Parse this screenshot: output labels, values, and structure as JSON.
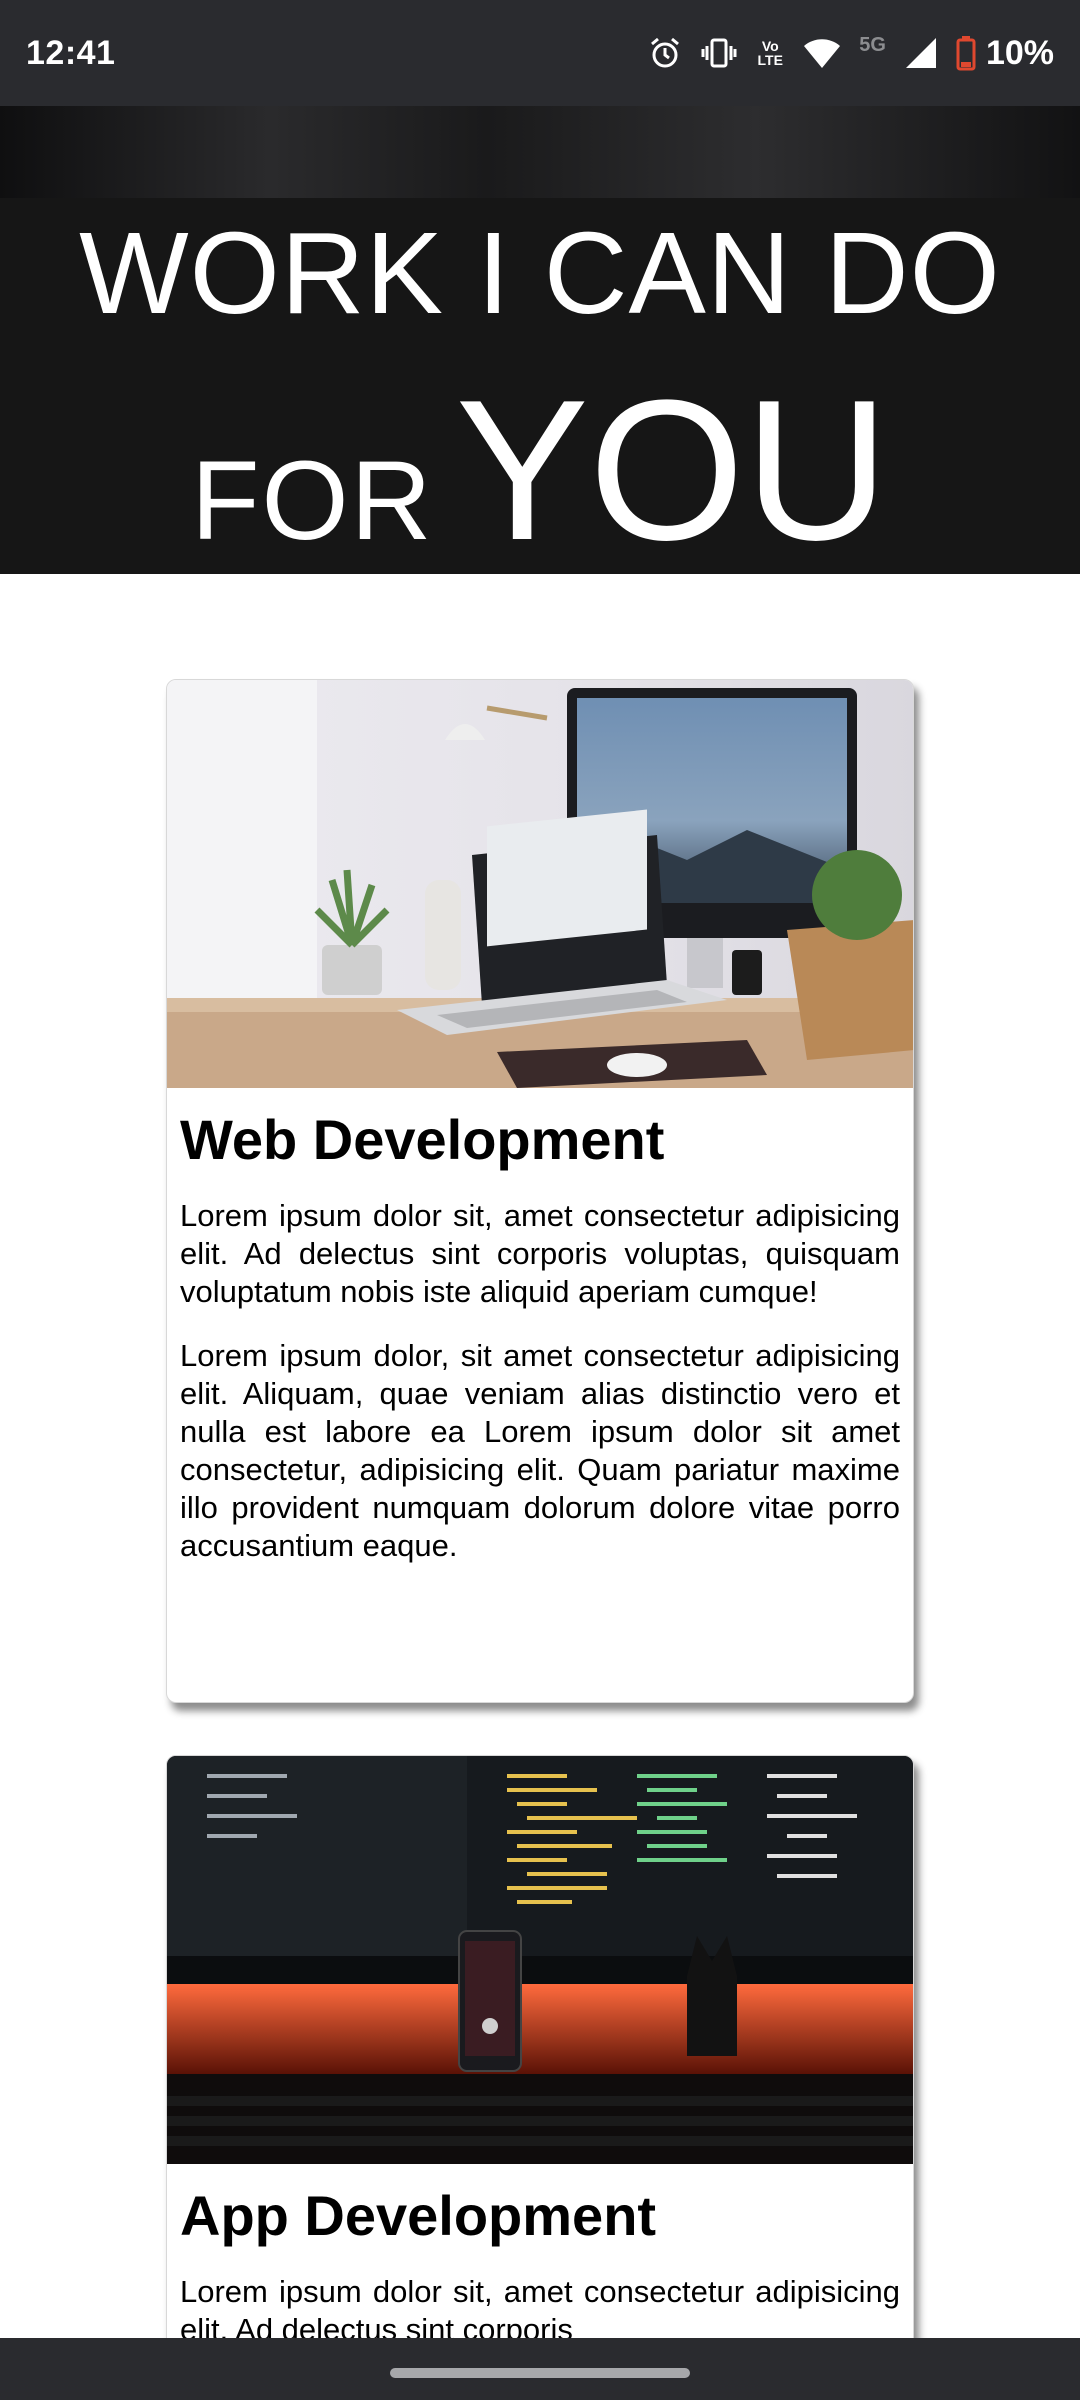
{
  "status_bar": {
    "time": "12:41",
    "network_label": "5G",
    "volte_label": "Vo\nLTE",
    "battery": "10%",
    "icons": [
      "alarm-icon",
      "vibrate-icon",
      "volte-icon",
      "wifi-icon",
      "signal-icon",
      "battery-low-icon"
    ]
  },
  "hero": {
    "line1": "WORK I CAN DO",
    "line2_small": "FOR",
    "line2_big": "YOU"
  },
  "cards": [
    {
      "title": "Web Development",
      "image": "desk-workspace-image",
      "paragraphs": [
        "Lorem ipsum dolor sit, amet consectetur adipisicing elit. Ad delectus sint corporis voluptas, quisquam voluptatum nobis iste aliquid aperiam cumque!",
        "Lorem ipsum dolor, sit amet consectetur adipisicing elit. Aliquam, quae veniam alias distinctio vero et nulla est labore ea Lorem ipsum dolor sit amet consectetur, adipisicing elit. Quam pariatur maxime illo provident numquam dolorum dolore vitae porro accusantium eaque."
      ]
    },
    {
      "title": "App Development",
      "image": "code-monitors-image",
      "paragraphs": [
        "Lorem ipsum dolor sit, amet consectetur adipisicing elit. Ad delectus sint corporis"
      ]
    }
  ],
  "colors": {
    "status_bg": "#2a2b2f",
    "hero_bg": "#161616",
    "text": "#000000",
    "battery_low": "#e0482f"
  }
}
